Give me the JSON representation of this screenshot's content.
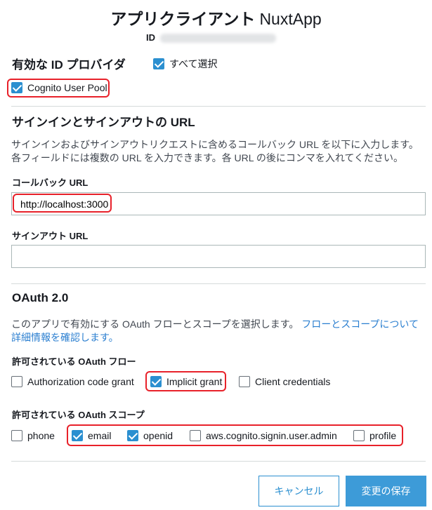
{
  "header": {
    "title": "アプリクライアント",
    "app_name": "NuxtApp",
    "id_label": "ID"
  },
  "providers": {
    "title": "有効な ID プロバイダ",
    "select_all_label": "すべて選択",
    "select_all_checked": true,
    "items": [
      {
        "label": "Cognito User Pool",
        "checked": true
      }
    ]
  },
  "urls": {
    "title": "サインインとサインアウトの URL",
    "description_line1": "サインインおよびサインアウトリクエストに含めるコールバック URL を以下に入力します。",
    "description_line2": "各フィールドには複数の URL を入力できます。各 URL の後にコンマを入れてください。",
    "callback_label": "コールバック URL",
    "callback_value": "http://localhost:3000",
    "signout_label": "サインアウト URL",
    "signout_value": ""
  },
  "oauth": {
    "title": "OAuth 2.0",
    "description_text": "このアプリで有効にする OAuth フローとスコープを選択します。",
    "description_link_line1": "フローとスコープについて",
    "description_link_line2": "詳細情報を確認します。",
    "flows_label": "許可されている OAuth フロー",
    "flows": [
      {
        "label": "Authorization code grant",
        "checked": false
      },
      {
        "label": "Implicit grant",
        "checked": true
      },
      {
        "label": "Client credentials",
        "checked": false
      }
    ],
    "scopes_label": "許可されている OAuth スコープ",
    "scopes": [
      {
        "label": "phone",
        "checked": false
      },
      {
        "label": "email",
        "checked": true
      },
      {
        "label": "openid",
        "checked": true
      },
      {
        "label": "aws.cognito.signin.user.admin",
        "checked": false
      },
      {
        "label": "profile",
        "checked": false
      }
    ]
  },
  "actions": {
    "cancel_label": "キャンセル",
    "save_label": "変更の保存"
  },
  "colors": {
    "accent": "#2b8fd0",
    "highlight": "#e8212a"
  }
}
